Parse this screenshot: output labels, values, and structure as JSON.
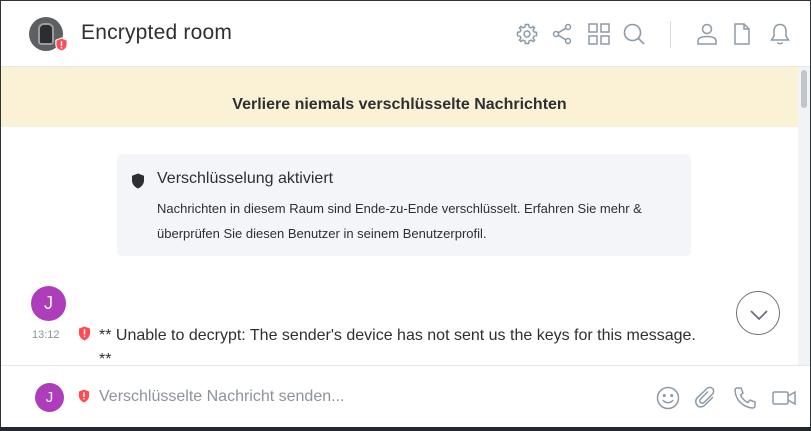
{
  "header": {
    "room_name": "Encrypted room",
    "icons": [
      "settings-icon",
      "share-icon",
      "apps-icon",
      "search-icon",
      "member-list-icon",
      "files-icon",
      "notifications-icon"
    ]
  },
  "banner": {
    "text": "Verliere niemals verschlüsselte Nachrichten"
  },
  "encryption_notice": {
    "title": "Verschlüsselung aktiviert",
    "body": "Nachrichten in diesem Raum sind Ende-zu-Ende verschlüsselt. Erfahren Sie mehr & überprüfen Sie diesen Benutzer in seinem Benutzerprofil."
  },
  "timeline": {
    "message": {
      "sender_initial": "J",
      "time": "13:12",
      "text": "** Unable to decrypt: The sender's device has not sent us the keys for this message. **"
    }
  },
  "composer": {
    "user_initial": "J",
    "placeholder": "Verschlüsselte Nachricht senden...",
    "value": "",
    "icons": [
      "emoji-icon",
      "attachment-icon",
      "voice-call-icon",
      "video-call-icon"
    ]
  },
  "colors": {
    "accent_avatar": "#ad3dba",
    "warning_red": "#ff4b55",
    "banner_bg": "#fbf2d5",
    "icon_color": "#8d99a5"
  }
}
